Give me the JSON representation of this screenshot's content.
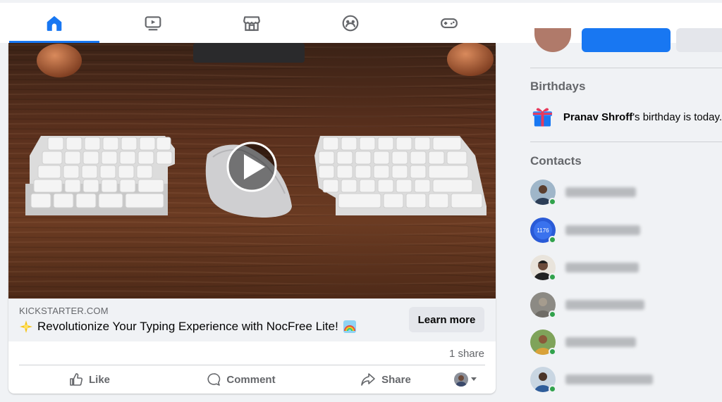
{
  "nav": {
    "tabs": [
      {
        "name": "home",
        "active": true
      },
      {
        "name": "watch",
        "active": false
      },
      {
        "name": "marketplace",
        "active": false
      },
      {
        "name": "groups",
        "active": false
      },
      {
        "name": "gaming",
        "active": false
      }
    ],
    "accent": "#1877f2"
  },
  "post": {
    "link_domain": "KICKSTARTER.COM",
    "link_title": "Revolutionize Your Typing Experience with NocFree Lite!",
    "learn_more": "Learn more",
    "shares": "1 share",
    "actions": {
      "like": "Like",
      "comment": "Comment",
      "share": "Share"
    },
    "icons": [
      "sparkle-icon",
      "rainbow-icon",
      "play-icon",
      "like-icon",
      "comment-icon",
      "share-icon",
      "dropdown-caret-icon"
    ]
  },
  "sidebar": {
    "birthdays_heading": "Birthdays",
    "birthday_name": "Pranav Shroff",
    "birthday_text": "'s birthday is today.",
    "contacts_heading": "Contacts",
    "contacts_count_visible": 6,
    "online_color": "#31a24c",
    "avatar_badge_text": "1176"
  }
}
